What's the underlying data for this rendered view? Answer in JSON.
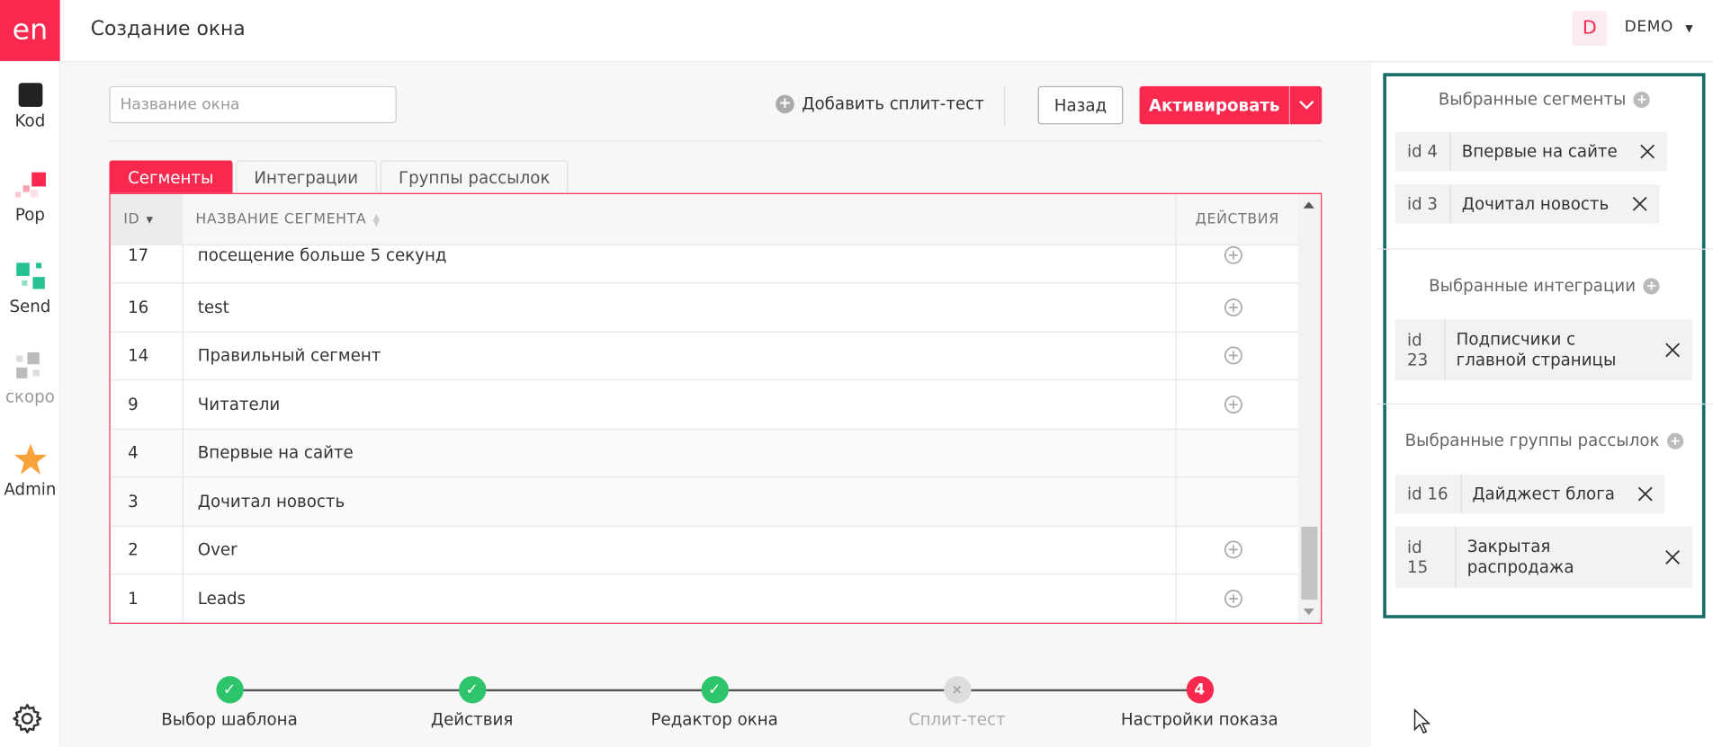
{
  "app": {
    "logo_text": "en",
    "page_title": "Создание окна"
  },
  "leftnav": {
    "items": [
      {
        "label": "Kod",
        "icon": "kod-icon"
      },
      {
        "label": "Pop",
        "icon": "pop-icon"
      },
      {
        "label": "Send",
        "icon": "send-icon"
      },
      {
        "label": "скоро",
        "icon": "grid-icon"
      },
      {
        "label": "Admin",
        "icon": "star-icon"
      }
    ],
    "settings_icon": "gear-icon"
  },
  "header": {
    "avatar_letter": "D",
    "account_label": "DEMO"
  },
  "toolbar": {
    "name_placeholder": "Название окна",
    "name_value": "",
    "split_test_label": "Добавить сплит-тест",
    "back_label": "Назад",
    "activate_label": "Активировать"
  },
  "tabs": [
    {
      "label": "Сегменты",
      "active": true
    },
    {
      "label": "Интеграции",
      "active": false
    },
    {
      "label": "Группы рассылок",
      "active": false
    }
  ],
  "table": {
    "columns": {
      "id": "ID",
      "name": "НАЗВАНИЕ СЕГМЕНТА",
      "actions": "ДЕЙСТВИЯ"
    },
    "rows": [
      {
        "id": "17",
        "name": "посещение больше 5 секунд",
        "addable": true
      },
      {
        "id": "16",
        "name": "test",
        "addable": true
      },
      {
        "id": "14",
        "name": "Правильный сегмент",
        "addable": true
      },
      {
        "id": "9",
        "name": "Читатели",
        "addable": true
      },
      {
        "id": "4",
        "name": "Впервые на сайте",
        "addable": false
      },
      {
        "id": "3",
        "name": "Дочитал новость",
        "addable": false
      },
      {
        "id": "2",
        "name": "Over",
        "addable": true
      },
      {
        "id": "1",
        "name": "Leads",
        "addable": true
      }
    ]
  },
  "stepper": {
    "steps": [
      {
        "label": "Выбор шаблона",
        "state": "done",
        "mark": "✓"
      },
      {
        "label": "Действия",
        "state": "done",
        "mark": "✓"
      },
      {
        "label": "Редактор окна",
        "state": "done",
        "mark": "✓"
      },
      {
        "label": "Сплит-тест",
        "state": "skipped",
        "mark": "✕"
      },
      {
        "label": "Настройки показа",
        "state": "current",
        "mark": "4"
      }
    ]
  },
  "rightpanel": {
    "segments_title": "Выбранные сегменты",
    "segments": [
      {
        "id": "id 4",
        "name": "Впервые на сайте"
      },
      {
        "id": "id 3",
        "name": "Дочитал новость"
      }
    ],
    "integrations_title": "Выбранные интеграции",
    "integrations": [
      {
        "id": "id 23",
        "name": "Подписчики с главной страницы"
      }
    ],
    "groups_title": "Выбранные группы рассылок",
    "groups": [
      {
        "id": "id 16",
        "name": "Дайджест блога"
      },
      {
        "id": "id 15",
        "name": "Закрытая распродажа"
      }
    ]
  },
  "colors": {
    "accent": "#f8284f",
    "success": "#2ec46c",
    "panel_border": "#176e66"
  }
}
